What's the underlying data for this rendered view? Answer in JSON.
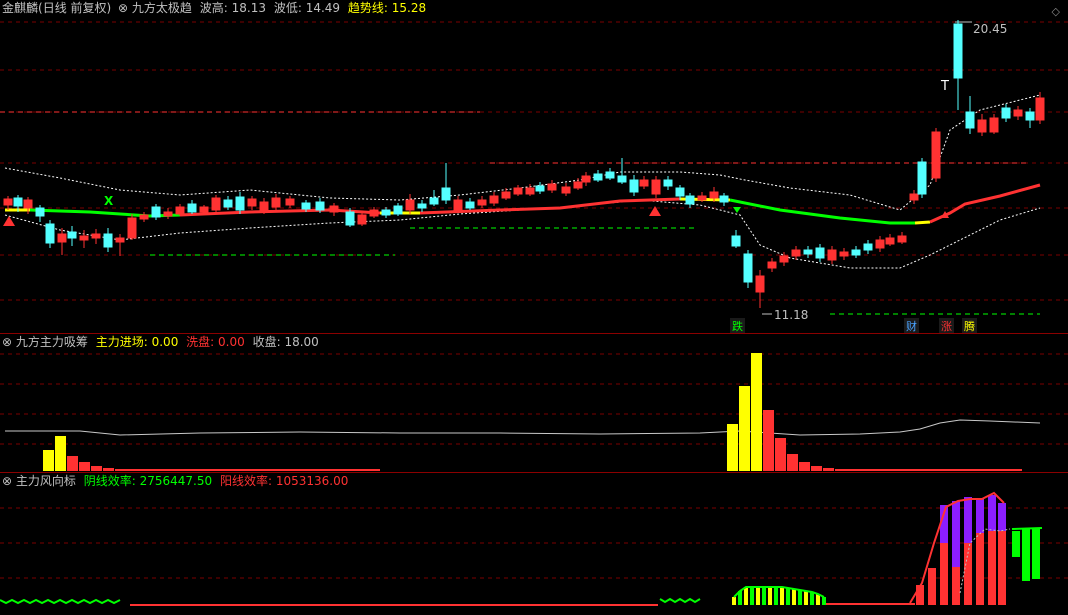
{
  "main": {
    "stock_name": "金麒麟",
    "period": "(日线 前复权)",
    "indicator_name": "九方太极趋",
    "high_label": "波高:",
    "high_value": "18.13",
    "low_label": "波低:",
    "low_value": "14.49",
    "trend_label": "趋势线:",
    "trend_value": "15.28",
    "peak_price": "20.45",
    "trough_price": "11.18",
    "marker_T": "T",
    "marker_x": "X",
    "badge_die": "跌",
    "badge_cai": "财",
    "badge_zhang": "涨",
    "badge_teng": "腾"
  },
  "panel2": {
    "indicator_name": "九方主力吸筹",
    "entry_label": "主力进场:",
    "entry_value": "0.00",
    "wash_label": "洗盘:",
    "wash_value": "0.00",
    "close_label": "收盘:",
    "close_value": "18.00"
  },
  "panel3": {
    "indicator_name": "主力风向标",
    "yin_label": "阴线效率:",
    "yin_value": "2756447.50",
    "yang_label": "阳线效率:",
    "yang_value": "1053136.00"
  },
  "colors": {
    "up": "#ff3232",
    "down": "#54ffff",
    "green": "#00ff00",
    "yellow": "#ffff00",
    "purple": "#8c1eff",
    "white": "#ffffff",
    "label_yellow": "#ffff00",
    "label_red": "#ff3232",
    "label_green": "#00ff00"
  }
}
